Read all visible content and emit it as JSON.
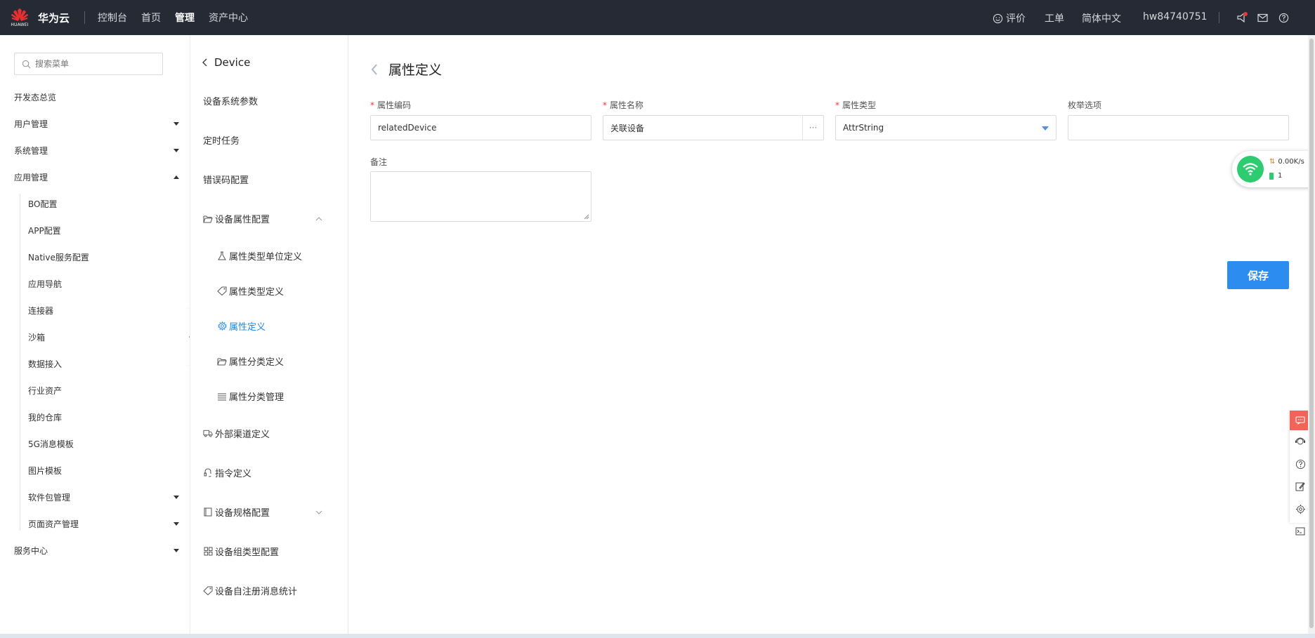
{
  "topbar": {
    "logo_text": "HUAWEI",
    "brand": "华为云",
    "nav": [
      "控制台",
      "首页",
      "管理",
      "资产中心"
    ],
    "active_nav": "管理",
    "feedback": "评价",
    "ticket": "工单",
    "language": "简体中文",
    "user": "hw84740751"
  },
  "sidebar": {
    "search_placeholder": "搜索菜单",
    "items": [
      {
        "label": "开发态总览",
        "caret": "none"
      },
      {
        "label": "用户管理",
        "caret": "down"
      },
      {
        "label": "系统管理",
        "caret": "down"
      },
      {
        "label": "应用管理",
        "caret": "up"
      }
    ],
    "subitems": [
      {
        "label": "BO配置"
      },
      {
        "label": "APP配置"
      },
      {
        "label": "Native服务配置"
      },
      {
        "label": "应用导航"
      },
      {
        "label": "连接器"
      },
      {
        "label": "沙箱"
      },
      {
        "label": "数据接入"
      },
      {
        "label": "行业资产"
      },
      {
        "label": "我的仓库"
      },
      {
        "label": "5G消息模板"
      },
      {
        "label": "图片模板"
      },
      {
        "label": "软件包管理",
        "caret": "down"
      },
      {
        "label": "页面资产管理",
        "caret": "down"
      }
    ],
    "last_item": "服务中心"
  },
  "sidebar2": {
    "title": "Device",
    "items": [
      "设备系统参数",
      "定时任务",
      "错误码配置",
      "设备属性配置",
      "外部渠道定义",
      "指令定义",
      "设备规格配置",
      "设备组类型配置",
      "设备自注册消息统计"
    ],
    "subitems": [
      "属性类型单位定义",
      "属性类型定义",
      "属性定义",
      "属性分类定义",
      "属性分类管理"
    ],
    "active_sub": "属性定义"
  },
  "main": {
    "title": "属性定义",
    "fields": {
      "code_label": "属性编码",
      "code_value": "relatedDevice",
      "name_label": "属性名称",
      "name_value": "关联设备",
      "name_dots": "···",
      "type_label": "属性类型",
      "type_value": "AttrString",
      "enum_label": "枚举选项",
      "enum_value": "",
      "remark_label": "备注",
      "remark_value": ""
    },
    "save_label": "保存"
  },
  "network_widget": {
    "speed": "0.00K/s",
    "count": "1"
  },
  "colors": {
    "topbar_bg": "#252a35",
    "accent": "#2d8cf0",
    "active_menu": "#1e88e5",
    "required": "#e53935",
    "wifi": "#2ecc71",
    "toolbar_first": "#f0645a"
  }
}
